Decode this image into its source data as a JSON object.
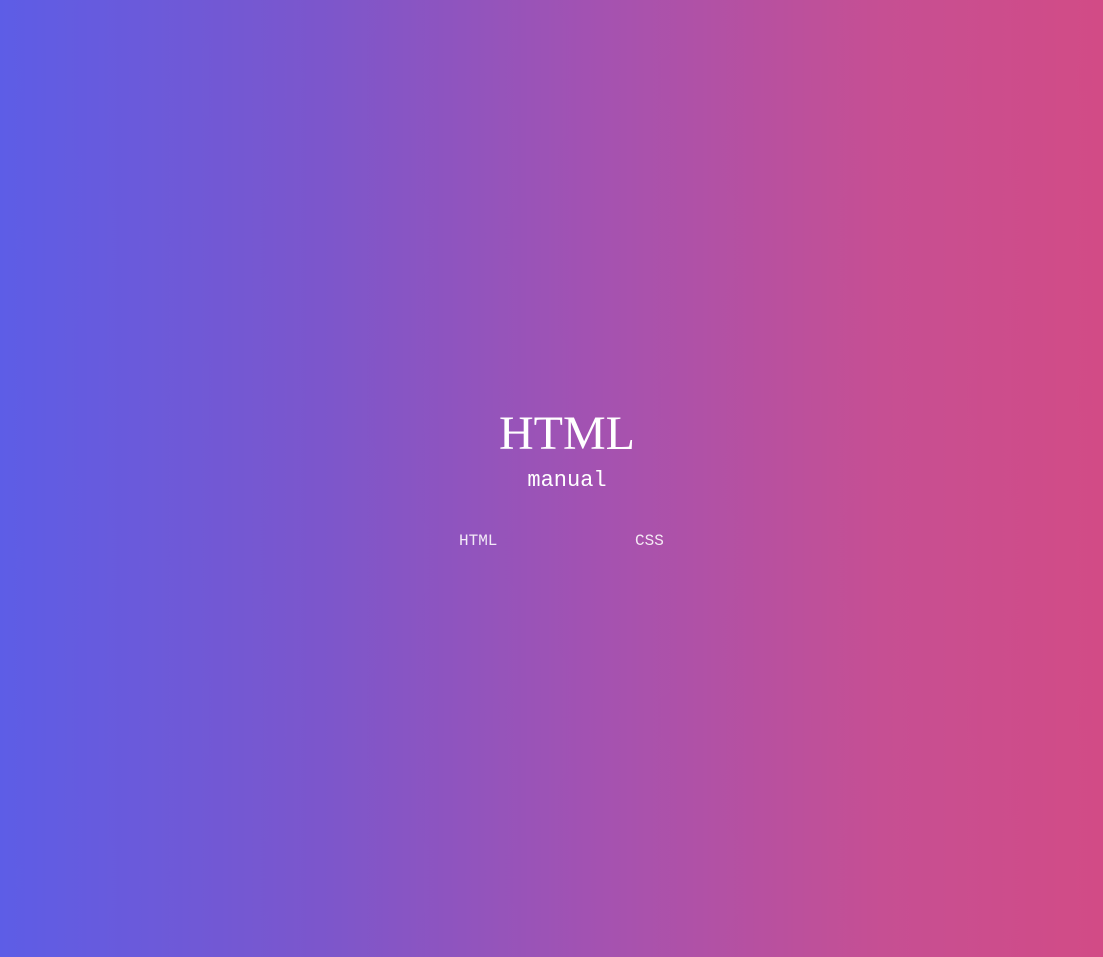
{
  "hero": {
    "title": "HTML",
    "subtitle": "manual"
  },
  "nav": {
    "links": [
      {
        "label": "HTML"
      },
      {
        "label": "CSS"
      }
    ]
  },
  "colors": {
    "gradient_start": "#5d5de6",
    "gradient_end": "#d24b86",
    "text": "#ffffff"
  }
}
